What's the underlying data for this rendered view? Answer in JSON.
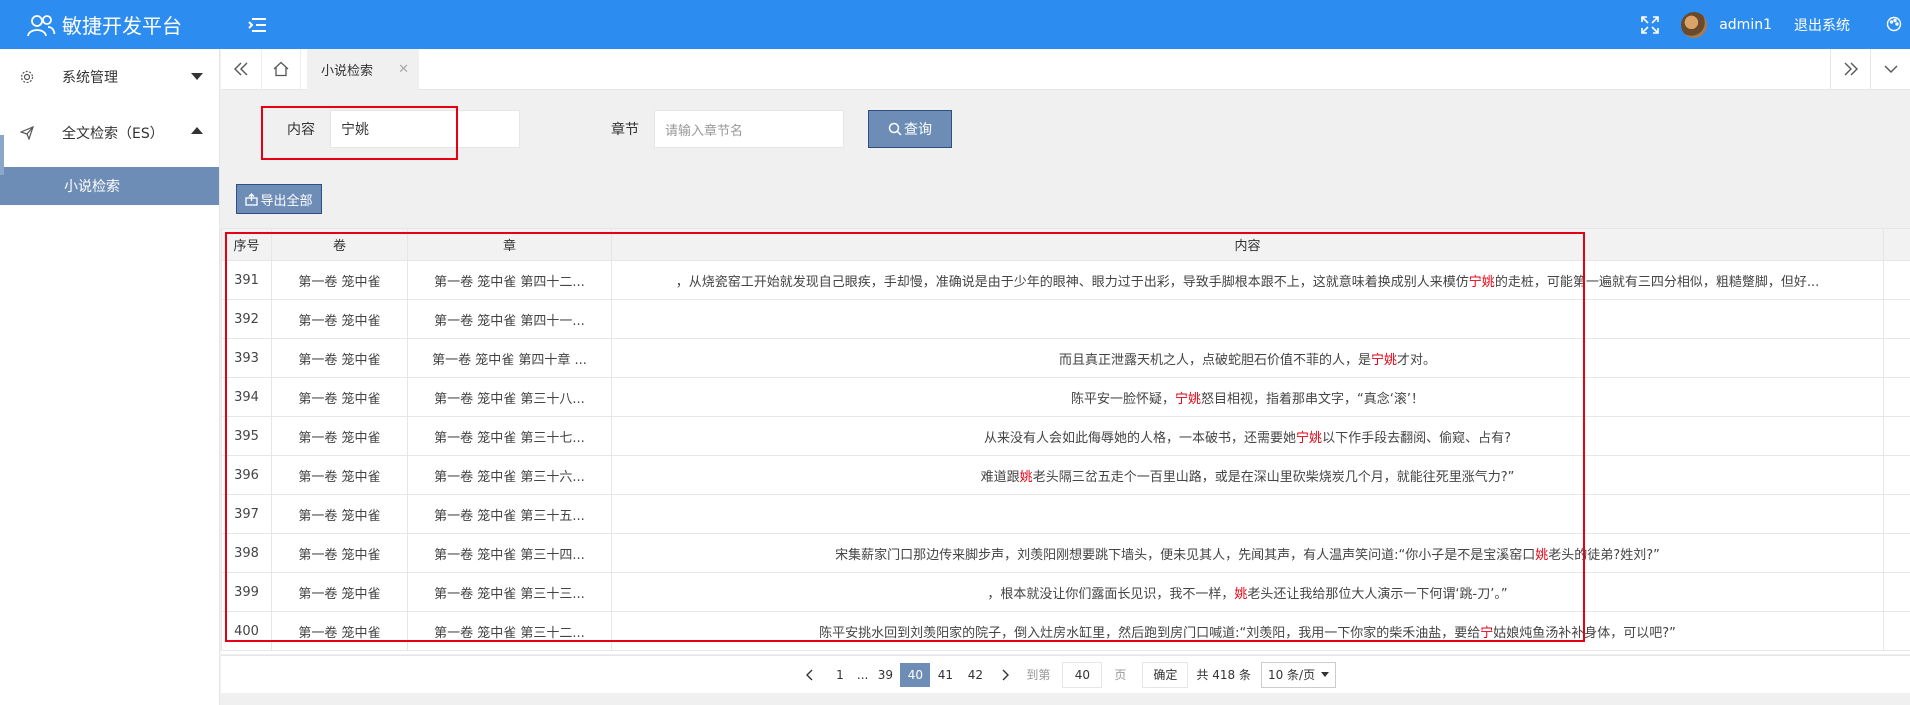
{
  "header": {
    "app_title": "敏捷开发平台",
    "username": "admin1",
    "logout_label": "退出系统"
  },
  "sidebar": {
    "items": [
      {
        "label": "系统管理"
      },
      {
        "label": "全文检索（ES）"
      }
    ],
    "subitems": [
      {
        "label": "小说检索"
      }
    ]
  },
  "tabs": {
    "active_label": "小说检索",
    "close_glyph": "✕"
  },
  "search": {
    "content_label": "内容",
    "content_value": "宁姚",
    "chapter_label": "章节",
    "chapter_placeholder": "请输入章节名",
    "query_label": "查询",
    "export_label": "导出全部"
  },
  "table": {
    "columns": [
      "序号",
      "卷",
      "章",
      "内容"
    ],
    "rows": [
      {
        "no": "391",
        "vol": "第一卷 笼中雀",
        "chap": "第一卷 笼中雀 第四十二...",
        "pre": "，从烧瓷窑工开始就发现自己眼疾，手却慢，准确说是由于少年的眼神、眼力过于出彩，导致手脚根本跟不上，这就意味着换成别人来模仿",
        "hl": "宁姚",
        "post": "的走桩，可能第一遍就有三四分相似，粗糙蹩脚，但好..."
      },
      {
        "no": "392",
        "vol": "第一卷 笼中雀",
        "chap": "第一卷 笼中雀 第四十一...",
        "pre": "",
        "hl": "",
        "post": ""
      },
      {
        "no": "393",
        "vol": "第一卷 笼中雀",
        "chap": "第一卷 笼中雀 第四十章 ...",
        "pre": "而且真正泄露天机之人，点破蛇胆石价值不菲的人，是",
        "hl": "宁姚",
        "post": "才对。"
      },
      {
        "no": "394",
        "vol": "第一卷 笼中雀",
        "chap": "第一卷 笼中雀 第三十八...",
        "pre": "陈平安一脸怀疑，",
        "hl": "宁姚",
        "post": "怒目相视，指着那串文字，“真念‘滚’！"
      },
      {
        "no": "395",
        "vol": "第一卷 笼中雀",
        "chap": "第一卷 笼中雀 第三十七...",
        "pre": "从来没有人会如此侮辱她的人格，一本破书，还需要她",
        "hl": "宁姚",
        "post": "以下作手段去翻阅、偷窥、占有?"
      },
      {
        "no": "396",
        "vol": "第一卷 笼中雀",
        "chap": "第一卷 笼中雀 第三十六...",
        "pre": "难道跟",
        "hl": "姚",
        "post": "老头隔三岔五走个一百里山路，或是在深山里砍柴烧炭几个月，就能往死里涨气力?”"
      },
      {
        "no": "397",
        "vol": "第一卷 笼中雀",
        "chap": "第一卷 笼中雀 第三十五...",
        "pre": "",
        "hl": "",
        "post": ""
      },
      {
        "no": "398",
        "vol": "第一卷 笼中雀",
        "chap": "第一卷 笼中雀 第三十四...",
        "pre": "宋集薪家门口那边传来脚步声，刘羡阳刚想要跳下墙头，便未见其人，先闻其声，有人温声笑问道:“你小子是不是宝溪窑口",
        "hl": "姚",
        "post": "老头的徒弟?姓刘?”"
      },
      {
        "no": "399",
        "vol": "第一卷 笼中雀",
        "chap": "第一卷 笼中雀 第三十三...",
        "pre": "，根本就没让你们露面长见识，我不一样，",
        "hl": "姚",
        "post": "老头还让我给那位大人演示一下何谓‘跳-刀’。”"
      },
      {
        "no": "400",
        "vol": "第一卷 笼中雀",
        "chap": "第一卷 笼中雀 第三十二...",
        "pre": "陈平安挑水回到刘羡阳家的院子，倒入灶房水缸里，然后跑到房门口喊道:“刘羡阳，我用一下你家的柴禾油盐，要给",
        "hl": "宁",
        "post": "姑娘炖鱼汤补补身体，可以吧?”"
      }
    ]
  },
  "pagination": {
    "pages": [
      "1",
      "...",
      "39",
      "40",
      "41",
      "42"
    ],
    "current": "40",
    "goto_label": "到第",
    "goto_value": "40",
    "page_unit": "页",
    "confirm_label": "确定",
    "total_label": "共 418 条",
    "page_size_label": "10 条/页"
  },
  "colors": {
    "header_bg": "#2d8cf0",
    "accent": "#6d8db6",
    "highlight": "#e60012"
  }
}
